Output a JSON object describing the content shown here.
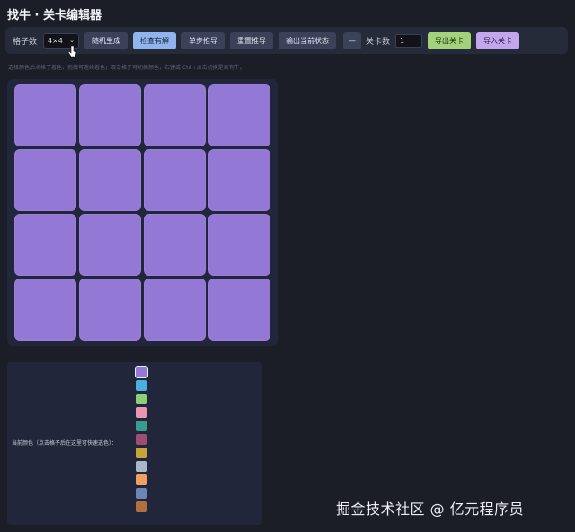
{
  "app": {
    "title": "找牛 · 关卡编辑器"
  },
  "toolbar": {
    "grid_label": "格子数",
    "grid_select_value": "4×4",
    "buttons": {
      "random": "随机生成",
      "check": "检查有解",
      "step": "单步推导",
      "reset": "重置推导",
      "output": "输出当前状态",
      "dash": "—",
      "export": "导出关卡",
      "import": "导入关卡"
    },
    "level_label": "关卡数",
    "level_value": "1"
  },
  "hint": "选择颜色后点格子着色，拖拽可连续着色；双击格子可切换颜色，右键或 Ctrl+点击切换是否有牛。",
  "grid": {
    "rows": 4,
    "cols": 4,
    "cell_color": "#9478d6"
  },
  "palette": {
    "label": "当前颜色（点击格子后在这里可快速选色）：",
    "colors": [
      "#9478d6",
      "#4bb0e0",
      "#8bd078",
      "#e796b4",
      "#3a9c8e",
      "#9c4e74",
      "#c8a23a",
      "#a8b8c8",
      "#f0a060",
      "#6a86b8",
      "#b07040"
    ],
    "selected_index": 0
  },
  "watermark": "掘金技术社区 @ 亿元程序员"
}
